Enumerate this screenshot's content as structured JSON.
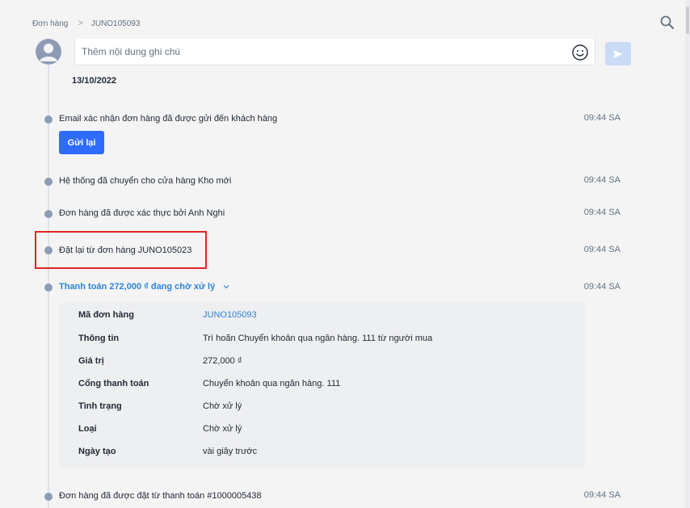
{
  "breadcrumb": {
    "parent": "Đơn hàng",
    "separator": ">",
    "current": "JUNO105093"
  },
  "composer": {
    "placeholder": "Thêm nội dung ghi chú"
  },
  "date_group": "13/10/2022",
  "events": [
    {
      "text": "Email xác nhận đơn hàng đã được gửi đến khách hàng",
      "time": "09:44 SA",
      "action_label": "Gửi lại"
    },
    {
      "text": "Hệ thống đã chuyển cho cửa hàng Kho mới",
      "time": "09:44 SA"
    },
    {
      "text": "Đơn hàng đã được xác thực bởi Anh Nghi",
      "time": "09:44 SA"
    },
    {
      "text": "Đặt lại từ đơn hàng JUNO105023",
      "time": "09:44 SA",
      "highlighted": true
    },
    {
      "text": "Thanh toán 272,000 ₫ đang chờ xử lý",
      "time": "09:44 SA",
      "expanded": true
    },
    {
      "text": "Đơn hàng đã được đặt từ thanh toán #1000005438",
      "time": "09:44 SA"
    }
  ],
  "payment_details": [
    {
      "label": "Mã đơn hàng",
      "value": "JUNO105093",
      "is_link": true
    },
    {
      "label": "Thông tin",
      "value": "Trì hoãn Chuyển khoản qua ngân hàng. 111 từ người mua"
    },
    {
      "label": "Giá trị",
      "value": "272,000 ₫"
    },
    {
      "label": "Cổng thanh toán",
      "value": "Chuyển khoản qua ngân hàng. 111"
    },
    {
      "label": "Tình trạng",
      "value": "Chờ xử lý"
    },
    {
      "label": "Loại",
      "value": "Chờ xử lý"
    },
    {
      "label": "Ngày tạo",
      "value": "vài giây trước"
    }
  ],
  "colors": {
    "accent": "#2f6bff",
    "link": "#2f84d8",
    "highlight": "#e02424",
    "dot": "#8d9bb5"
  },
  "icons": {
    "search": "search-icon",
    "smile": "smile-icon",
    "send": "send-icon",
    "avatar": "user-avatar-icon",
    "chevron": "chevron-down-icon"
  }
}
